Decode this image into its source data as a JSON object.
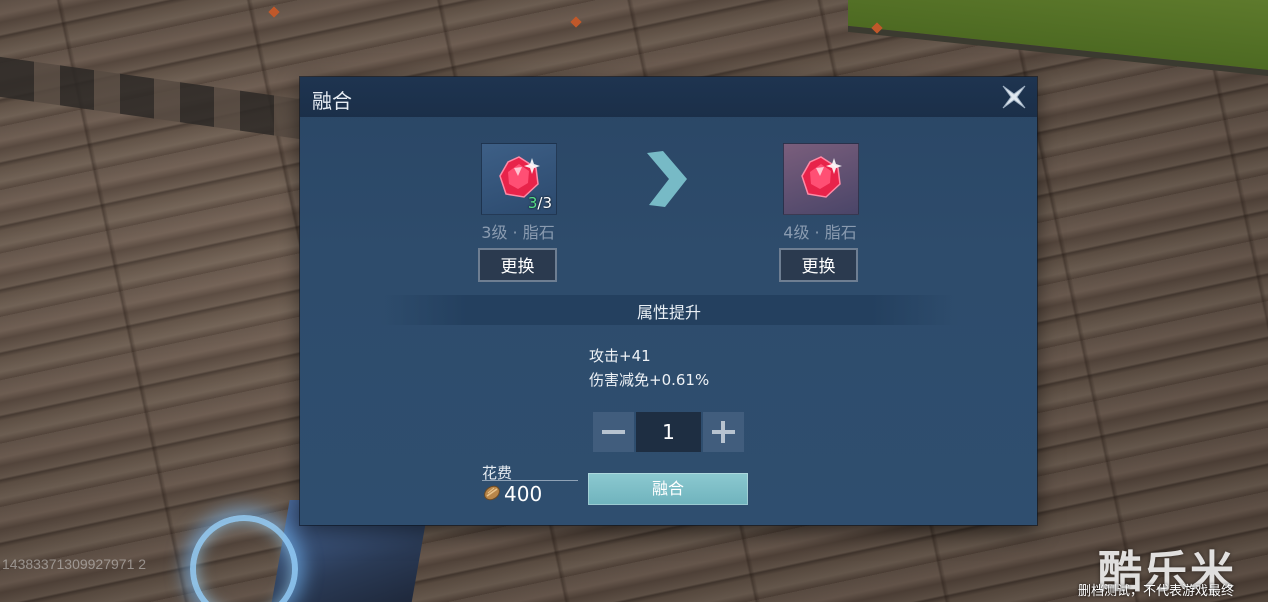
{
  "dialog": {
    "title": "融合",
    "close_icon": "close-x-icon"
  },
  "source_gem": {
    "icon": "red-gem-icon",
    "count_have": "3",
    "count_sep_total": "/3",
    "name": "3级 · 脂石",
    "swap_label": "更换"
  },
  "target_gem": {
    "icon": "red-gem-icon",
    "name": "4级 · 脂石",
    "swap_label": "更换"
  },
  "arrow_icon": "chevron-right-icon",
  "attributes": {
    "title": "属性提升",
    "lines": [
      "攻击+41",
      "伤害减免+0.61%"
    ]
  },
  "quantity": {
    "value": "1",
    "minus_icon": "minus-icon",
    "plus_icon": "plus-icon"
  },
  "cost": {
    "label": "花费",
    "icon": "coin-icon",
    "value": "400"
  },
  "fuse_button": {
    "label": "融合"
  },
  "overlay": {
    "id_watermark": "14383371309927971 2",
    "logo": "酷乐米",
    "notice": "删档测试，不代表游戏最终"
  },
  "colors": {
    "dialog_bg": "#2e4c6c",
    "header_bg": "#1e3450",
    "fuse_button": "#8cc9d0",
    "gem_red": "#e8234a",
    "count_green": "#58e08a"
  }
}
